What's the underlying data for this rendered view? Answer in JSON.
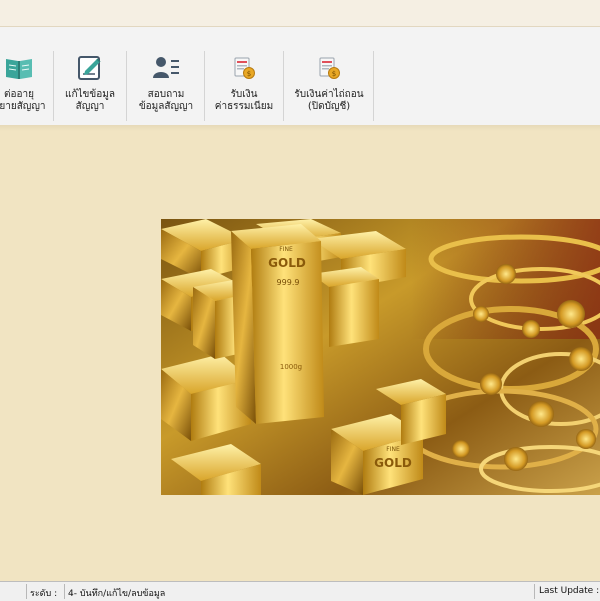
{
  "toolbar": {
    "buttons": [
      {
        "icon": "open-book-icon",
        "label_line1": "ต่ออายุ",
        "label_line2": "ขยายสัญญา"
      },
      {
        "icon": "edit-document-icon",
        "label_line1": "แก้ไขข้อมูล",
        "label_line2": "สัญญา"
      },
      {
        "icon": "user-list-icon",
        "label_line1": "สอบถาม",
        "label_line2": "ข้อมูลสัญญา"
      },
      {
        "icon": "receipt-coin-icon",
        "label_line1": "รับเงิน",
        "label_line2": "ค่าธรรมเนียม"
      },
      {
        "icon": "receipt-coin-icon",
        "label_line1": "รับเงินค่าไถ่ถอน",
        "label_line2": "(ปิดบัญชี)"
      }
    ]
  },
  "banner": {
    "bar_stamp_line1": "FINE",
    "bar_stamp_line2": "GOLD",
    "bar_stamp_line3": "999.9",
    "bar_weight": "1000g",
    "lower_bar_stamp_line1": "FINE",
    "lower_bar_stamp_line2": "GOLD"
  },
  "statusbar": {
    "level_label": "ระดับ :",
    "level_value": "4- บันทึก/แก้ไข/ลบข้อมูล",
    "last_update_label": "Last Update :"
  },
  "colors": {
    "workspace": "#f1e4c2",
    "toolbar": "#f3f3f3",
    "gold": "#d4a82a",
    "icon_teal": "#3aa59a",
    "icon_slate": "#45576a"
  }
}
